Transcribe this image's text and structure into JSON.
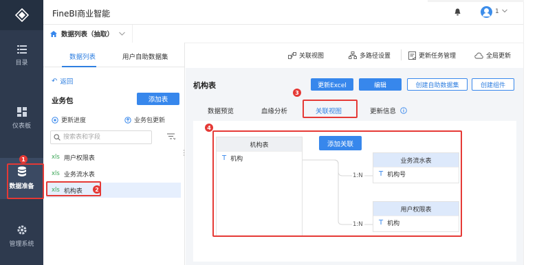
{
  "app": {
    "title": "FineBI商业智能",
    "user_count": "1"
  },
  "sidebar": {
    "items": [
      {
        "label": "目录",
        "icon": "list-icon"
      },
      {
        "label": "仪表板",
        "icon": "dashboard-icon"
      },
      {
        "label": "数据准备",
        "icon": "database-icon",
        "active": true
      },
      {
        "label": "管理系统",
        "icon": "gear-icon"
      }
    ]
  },
  "pagetab": {
    "label": "数据列表（抽取）"
  },
  "left_panel": {
    "tabs": [
      "数据列表",
      "用户自助数据集"
    ],
    "back": "返回",
    "section_title": "业务包",
    "add_table": "添加表",
    "update_progress": "更新进度",
    "update_package": "业务包更新",
    "search_placeholder": "搜索表和字段",
    "tables": [
      {
        "type": "xls",
        "name": "用户权限表"
      },
      {
        "type": "xls",
        "name": "业务流水表"
      },
      {
        "type": "xls",
        "name": "机构表",
        "selected": true
      }
    ]
  },
  "toolbar": {
    "relation_view": "关联视图",
    "multi_path": "多路径设置",
    "task_mgmt": "更新任务管理",
    "global_update": "全局更新"
  },
  "main": {
    "title": "机构表",
    "buttons": {
      "update_excel": "更新Excel",
      "edit": "编辑",
      "create_dataset": "创建自助数据集",
      "create_component": "创建组件"
    },
    "tabs": [
      "数据预览",
      "血缘分析",
      "关联视图",
      "更新信息"
    ],
    "active_tab": "关联视图",
    "add_relation": "添加关联",
    "nodes": {
      "source": {
        "title": "机构表",
        "field": "机构"
      },
      "target1": {
        "title": "业务流水表",
        "field": "机构号",
        "relation": "1:N"
      },
      "target2": {
        "title": "用户权限表",
        "field": "机构",
        "relation": "1:N"
      }
    }
  },
  "annotations": [
    "1",
    "2",
    "3",
    "4"
  ],
  "colors": {
    "sidebar_bg": "#2e3a4e",
    "accent": "#3787ec",
    "annotation": "#e53935",
    "xls": "#3aa655"
  }
}
